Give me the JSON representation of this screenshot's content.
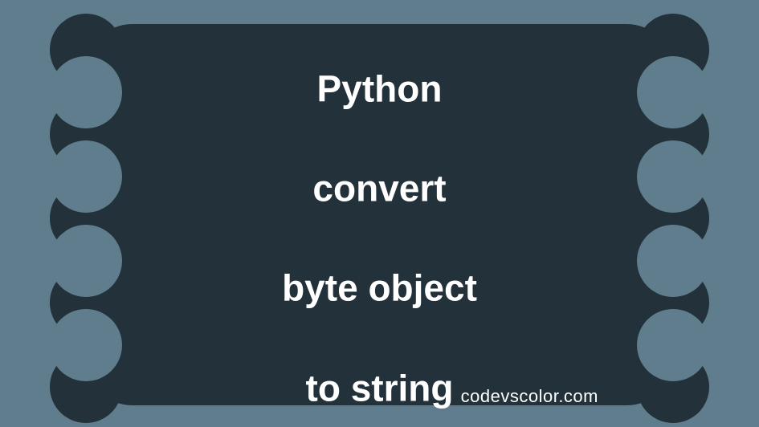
{
  "title": {
    "line1": "Python",
    "line2": "convert",
    "line3": "byte object",
    "line4": "to string"
  },
  "footer": {
    "site": "codevscolor.com"
  },
  "colors": {
    "background": "#5f7d8c",
    "blob": "#22313a",
    "text": "#ffffff"
  }
}
